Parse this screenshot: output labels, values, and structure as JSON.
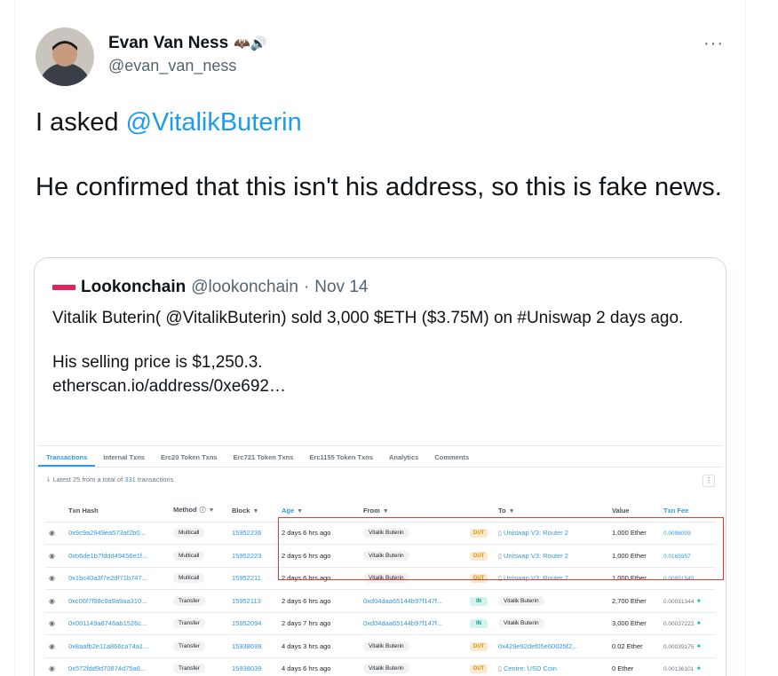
{
  "tweet": {
    "author_name": "Evan Van Ness",
    "author_emoji": "🦇🔊",
    "author_handle": "@evan_van_ness",
    "more_label": "···",
    "text_line1_prefix": "I asked ",
    "text_mention": "@VitalikButerin",
    "text_line2": "He confirmed that this isn't his address, so this is fake news."
  },
  "quote": {
    "author_name": "Lookonchain",
    "author_handle": "@lookonchain",
    "separator": "·",
    "date": "Nov 14",
    "text_para1": "Vitalik Buterin( @VitalikButerin) sold 3,000 $ETH ($3.75M) on #Uniswap 2 days ago.",
    "text_para2_line1": "His selling price is $1,250.3.",
    "text_para2_line2": "etherscan.io/address/0xe692…"
  },
  "etherscan": {
    "tabs": [
      "Transactions",
      "Internal Txns",
      "Erc20 Token Txns",
      "Erc721 Token Txns",
      "Erc1155 Token Txns",
      "Analytics",
      "Comments"
    ],
    "summary_prefix": "Latest 25 from a total of ",
    "summary_count": "331",
    "summary_suffix": " transactions",
    "kebab": "⋮",
    "headers": {
      "hash": "Txn Hash",
      "method": "Method",
      "block": "Block",
      "age": "Age",
      "from": "From",
      "to": "To",
      "value": "Value",
      "fee": "Txn Fee"
    },
    "rows": [
      {
        "hash": "0x9c9a2949ea573af2b0...",
        "method": "Multicall",
        "block": "15952236",
        "age": "2 days 6 hrs ago",
        "from": "Vitalik Buterin",
        "dir": "OUT",
        "to": "Uniswap V3: Router 2",
        "value": "1,000 Ether",
        "fee": "0.0096009"
      },
      {
        "hash": "0xb6de1b7fddd49456e1f...",
        "method": "Multicall",
        "block": "15952223",
        "age": "2 days 6 hrs ago",
        "from": "Vitalik Buterin",
        "dir": "OUT",
        "to": "Uniswap V3: Router 2",
        "value": "1,000 Ether",
        "fee": "0.0165957"
      },
      {
        "hash": "0x1bc40a3f7e2df71b747...",
        "method": "Multicall",
        "block": "15952211",
        "age": "2 days 6 hrs ago",
        "from": "Vitalik Buterin",
        "dir": "OUT",
        "to": "Uniswap V3: Router 2",
        "value": "1,000 Ether",
        "fee": "0.00951545"
      },
      {
        "hash": "0xc06f7f98c9a9a9aa310...",
        "method": "Transfer",
        "block": "15952113",
        "age": "2 days 6 hrs ago",
        "from": "0xd04daa65144b97f147f...",
        "dir": "IN",
        "to": "Vitalik Buterin",
        "value": "2,700 Ether",
        "fee": "0.00031344"
      },
      {
        "hash": "0x001149a8746ab1526c...",
        "method": "Transfer",
        "block": "15952094",
        "age": "2 days 7 hrs ago",
        "from": "0xd04daa65144b97f147f...",
        "dir": "IN",
        "to": "Vitalik Buterin",
        "value": "3,000 Ether",
        "fee": "0.00037222"
      },
      {
        "hash": "0x8aafb2e11a866ca74a1...",
        "method": "Transfer",
        "block": "15938699",
        "age": "4 days 3 hrs ago",
        "from": "Vitalik Buterin",
        "dir": "OUT",
        "to": "0x429e92def05e60025f2...",
        "value": "0.02 Ether",
        "fee": "0.00039175"
      },
      {
        "hash": "0x572fdd9d70874d75a6...",
        "method": "Transfer",
        "block": "15938039",
        "age": "4 days 6 hrs ago",
        "from": "Vitalik Buterin",
        "dir": "OUT",
        "to": "Centre: USD Coin",
        "value": "0 Ether",
        "fee": "0.00136101"
      }
    ]
  }
}
